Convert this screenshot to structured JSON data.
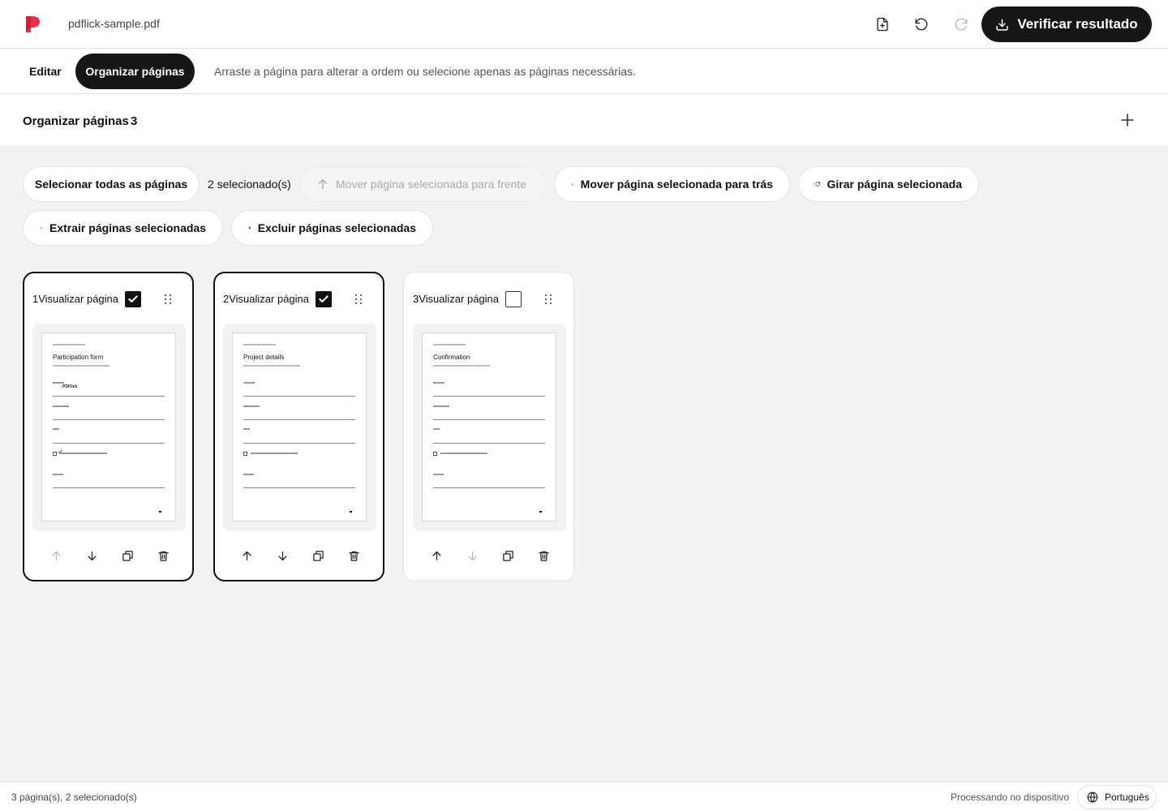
{
  "header": {
    "file_name": "pdflick-sample.pdf",
    "primary_button": "Verificar resultado",
    "brand_color": "#e5334b"
  },
  "tabs": {
    "edit": "Editar",
    "organize": "Organizar páginas",
    "hint": "Arraste a página para alterar a ordem ou selecione apenas as páginas necessárias."
  },
  "section": {
    "title": "Organizar páginas",
    "count": "3"
  },
  "actions": {
    "select_all": "Selecionar todas as páginas",
    "selected_count": "2 selecionado(s)",
    "move_forward": "Mover página selecionada para frente",
    "move_back": "Mover página selecionada para trás",
    "rotate": "Girar página selecionada",
    "extract": "Extrair páginas selecionadas",
    "delete": "Excluir páginas selecionadas"
  },
  "pages": [
    {
      "label": "1Visualizar página",
      "selected": true,
      "doc_title": "Participation form",
      "field_value": "PDFlick",
      "has_checkmark": true
    },
    {
      "label": "2Visualizar página",
      "selected": true,
      "doc_title": "Project details",
      "field_value": "",
      "has_checkmark": false
    },
    {
      "label": "3Visualizar página",
      "selected": false,
      "doc_title": "Confirmation",
      "field_value": "",
      "has_checkmark": false
    }
  ],
  "footer": {
    "status": "3 página(s), 2 selecionado(s)",
    "processing": "Processando no dispositivo",
    "language": "Português"
  }
}
